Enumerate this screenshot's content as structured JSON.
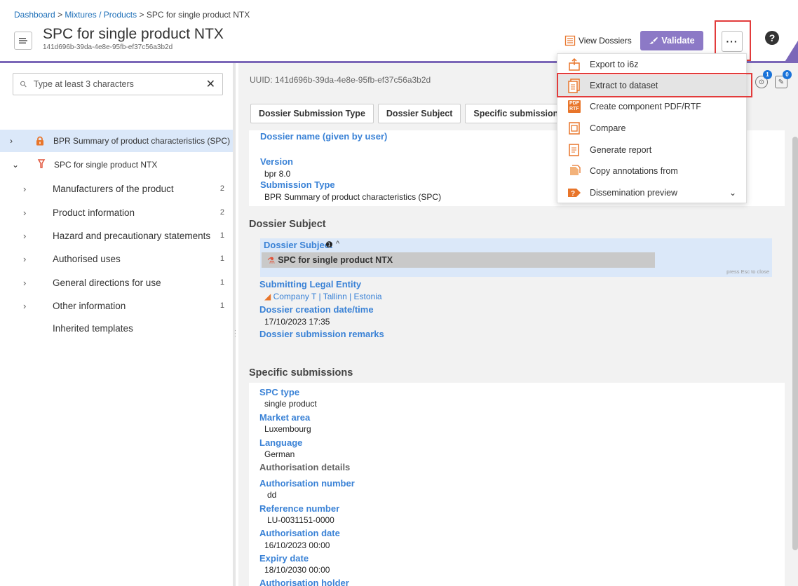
{
  "header": {
    "breadcrumb": {
      "dashboard": "Dashboard",
      "sep1": ">",
      "mixtures": "Mixtures / Products",
      "sep2": ">",
      "current": "SPC for single product NTX"
    },
    "title": "SPC for single product NTX",
    "uuid": "141d696b-39da-4e8e-95fb-ef37c56a3b2d",
    "view_dossiers_label": "View Dossiers",
    "validate_label": "Validate",
    "more_label": "···",
    "help_label": "?"
  },
  "sidebar": {
    "search_placeholder": "Type at least 3 characters",
    "clear_label": "✕",
    "root": "BPR Summary of product characteristics (SPC)",
    "subroot": "SPC for single product NTX",
    "items": [
      {
        "label": "Manufacturers of the product",
        "count": "2"
      },
      {
        "label": "Product information",
        "count": "2"
      },
      {
        "label": "Hazard and precautionary statements",
        "count": "1"
      },
      {
        "label": "Authorised uses",
        "count": "1"
      },
      {
        "label": "General directions for use",
        "count": "1"
      },
      {
        "label": "Other information",
        "count": "1"
      }
    ],
    "inherited": "Inherited templates"
  },
  "main": {
    "uuid_text": "UUID: 141d696b-39da-4e8e-95fb-ef37c56a3b2d",
    "badges": [
      "1",
      "0"
    ],
    "tabs": [
      "Dossier Submission Type",
      "Dossier Subject",
      "Specific submissions"
    ],
    "submission_type": {
      "dossier_name_label": "Dossier name (given by user)",
      "version_label": "Version",
      "version_value": "bpr 8.0",
      "submission_type_label": "Submission Type",
      "submission_type_value": "BPR Summary of product characteristics (SPC)"
    },
    "dossier_subject": {
      "section_title": "Dossier Subject",
      "subject_label": "Dossier Subject",
      "subject_value": "SPC for single product NTX",
      "esc_hint": "press Esc to close",
      "legal_entity_label": "Submitting Legal Entity",
      "legal_entity_value": "Company T | Tallinn | Estonia",
      "creation_label": "Dossier creation date/time",
      "creation_value": "17/10/2023 17:35",
      "remarks_label": "Dossier submission remarks"
    },
    "specific": {
      "section_title": "Specific submissions",
      "spc_type_label": "SPC type",
      "spc_type_value": "single product",
      "market_label": "Market area",
      "market_value": "Luxembourg",
      "language_label": "Language",
      "language_value": "German",
      "auth_details_label": "Authorisation details",
      "auth_number_label": "Authorisation number",
      "auth_number_value": "dd",
      "ref_number_label": "Reference number",
      "ref_number_value": "LU-0031151-0000",
      "auth_date_label": "Authorisation date",
      "auth_date_value": "16/10/2023 00:00",
      "expiry_label": "Expiry date",
      "expiry_value": "18/10/2030 00:00",
      "holder_label": "Authorisation holder"
    }
  },
  "dropdown": {
    "items": [
      {
        "label": "Export to i6z",
        "icon": "export-icon"
      },
      {
        "label": "Extract to dataset",
        "icon": "extract-icon"
      },
      {
        "label": "Create component PDF/RTF",
        "icon": "pdf-rtf-icon"
      },
      {
        "label": "Compare",
        "icon": "compare-icon"
      },
      {
        "label": "Generate report",
        "icon": "report-icon"
      },
      {
        "label": "Copy annotations from",
        "icon": "annotations-icon"
      },
      {
        "label": "Dissemination preview",
        "icon": "dissemination-icon"
      }
    ],
    "pdf_icon_text": "PDF",
    "rtf_icon_text": "RTF"
  },
  "colors": {
    "accent_purple": "#8c79c6",
    "link_blue": "#3a82d6",
    "highlight_red": "#e23b3b",
    "selected_bg": "#dbe8f9",
    "icon_orange": "#e8752a"
  }
}
